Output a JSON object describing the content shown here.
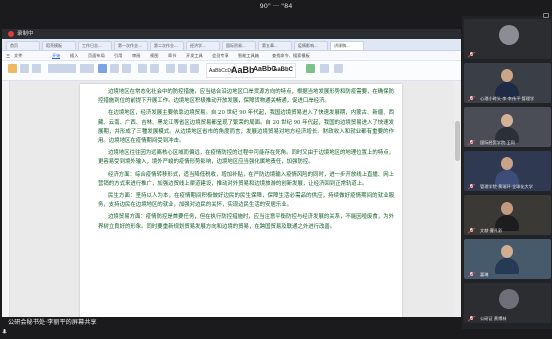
{
  "meeting": {
    "title": "90\" ··· \"84",
    "recording_label": "录制中"
  },
  "wps": {
    "tabs": [
      "首页",
      "稻壳模板",
      "工作日志...",
      "第一次作业...",
      "第二次作业...",
      "经济学...",
      "国际贸易...",
      "第五章...",
      "疫情影响...",
      "讲课稿..."
    ],
    "menu": [
      "三",
      "文件",
      "开始",
      "插入",
      "页面布局",
      "引用",
      "审阅",
      "视图",
      "章节",
      "开发工具",
      "会员专享",
      "智能工具箱",
      "查找命令、搜索模板"
    ],
    "active_menu": "开始",
    "style_samples": [
      "AaBbCcDd",
      "AaBb",
      "AaBbC",
      "AaBbC",
      "AaBbC"
    ]
  },
  "document": {
    "paragraphs": [
      "边境地区在常态化社会中的防控措施，应当结合沿边地区口岸货源方向的特点，根据当地发展形势和防疫需要，在确保防控措施到位的前提下开展工作。边境地区积极推动开放发展，保障货物通关畅通，促进口岸经济。",
      "在边境地区，经济发展主要依靠边境贸易。自 20 世纪 90 年代起，我国边境贸易进入了快速发展期，内蒙古、新疆、西藏、云南、广西、吉林、黑龙江等省区边境贸易都呈现了繁荣的局面。自 20 世纪 90 年代起，我国的边境贸易进入了快速发展期，并形成了三種发展模式。从边境地区省市的角度而言，发展边境贸易对地方经济增长、财政收入和就业都有重要的作用。边境地区在疫情期间受到冲击。",
      "边境地区往往因为远离核心区域而偏远，在疫情防控的过程中可能存在死角。同时又由于边境地区的地理位置上的特点，更容易受到境外输入，境外严峻的疫情形势影响，边境地区应当强化属地责任，加强防控。",
      "经济方面：综合疫情转移形式，适当降低税收，增加补贴，在严防边境输入疫情风险的同时，进一步开放线上直播、网上营销的方式来进行推广，加强边贸线上渠道建设，推动对外贸易和边境旅游的创新发展，让经济回到正常轨道上。",
      "民生方面：坚持以人为本，在疫情期间积极做好边民的民生保障，保障生活必需品的供应，持续做好疫情期间的就业服务，支持边民在边境地区的就业，加强对边民的关怀，实现边民生活的安居乐业。",
      "边境贸易方面：疫情防控是首要任务，但在执行防控措施时，应当注意平衡防控与经济发展的关系，不能因噎废食，为外界树立良好的形象。同时要重新规划贸易发展方向和边境的贸易，在跨国贸易及联通之外进行改善。"
    ]
  },
  "participants": [
    {
      "name": "",
      "type": "avatar"
    },
    {
      "name": "心理小砖头·李·李伟平·管理学",
      "type": "video"
    },
    {
      "name": "国际经贸学院·王同",
      "type": "video"
    },
    {
      "name": "管理学院·黄瑞环·全球化大学",
      "type": "video"
    },
    {
      "name": "文献·曹凡彩",
      "type": "video"
    },
    {
      "name": "嘉琳",
      "type": "video"
    },
    {
      "name": "公研证 黄博林",
      "type": "avatar"
    }
  ],
  "speaker": {
    "label": "公研会秘书处·李丽平的屏幕共享"
  }
}
